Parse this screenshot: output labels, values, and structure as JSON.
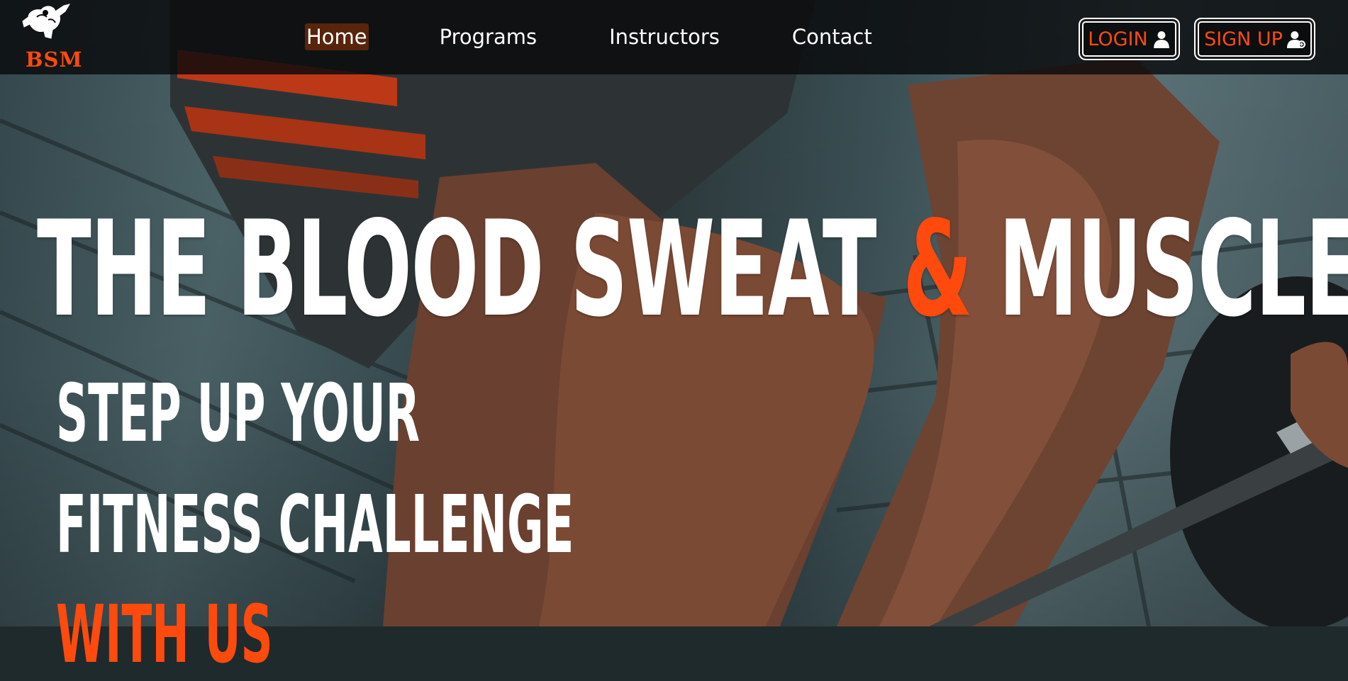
{
  "brand": {
    "logo_text": "BSM",
    "accent_color": "#ff4a0d"
  },
  "nav": {
    "links": [
      {
        "label": "Home",
        "active": true
      },
      {
        "label": "Programs",
        "active": false
      },
      {
        "label": "Instructors",
        "active": false
      },
      {
        "label": "Contact",
        "active": false
      }
    ]
  },
  "auth": {
    "login_label": "LOGIN",
    "login_icon": "user-icon",
    "signup_label": "SIGN UP",
    "signup_icon": "user-add-icon"
  },
  "hero": {
    "title_part1": "THE BLOOD SWEAT ",
    "title_amp": "&",
    "title_part2": " MUSCLES",
    "tagline_line1": "STEP UP YOUR",
    "tagline_line2": "FITNESS CHALLENGE",
    "tagline_line3": "WITH US"
  }
}
